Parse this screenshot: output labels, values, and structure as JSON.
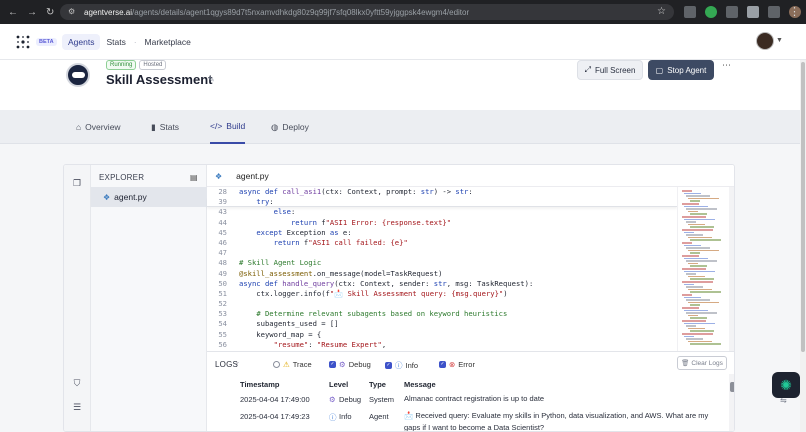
{
  "browser": {
    "url_host": "agentverse.ai",
    "url_path": "/agents/details/agent1qgys89d7t5nxamvdhkdg80z9q99jf7sfq08lkx0yftt59yjggpsk4ewgm4/editor"
  },
  "header": {
    "beta": "BETA",
    "nav": [
      {
        "label": "Agents",
        "active": true
      },
      {
        "label": "Stats",
        "active": false
      },
      {
        "label": "Marketplace",
        "active": false
      }
    ]
  },
  "agent": {
    "status_running": "Running",
    "status_hosted": "Hosted",
    "title": "Skill Assessment",
    "full_screen": "Full Screen",
    "stop_agent": "Stop Agent"
  },
  "tabs": [
    {
      "label": "Overview",
      "icon": "home-icon"
    },
    {
      "label": "Stats",
      "icon": "bar-chart-icon"
    },
    {
      "label": "Build",
      "icon": "code-icon",
      "active": true
    },
    {
      "label": "Deploy",
      "icon": "globe-icon"
    }
  ],
  "explorer": {
    "title": "EXPLORER",
    "file": "agent.py"
  },
  "editor": {
    "tab": "agent.py",
    "lines": [
      {
        "n": "28",
        "html": "<span class=\"kw\">async def</span> <span class=\"fn\">call_asi1</span>(ctx: Context, prompt: <span class=\"kw\">str</span>) -> <span class=\"kw\">str</span>:",
        "sticky": true
      },
      {
        "n": "39",
        "html": "    <span class=\"kw\">try</span>:",
        "sticky": true
      },
      {
        "n": "43",
        "html": "        <span class=\"kw\">else</span>:"
      },
      {
        "n": "44",
        "html": "            <span class=\"kw\">return</span> f<span class=\"str\">\"ASI1 Error: {response.text}\"</span>"
      },
      {
        "n": "45",
        "html": "    <span class=\"kw\">except</span> Exception <span class=\"kw\">as</span> e:"
      },
      {
        "n": "46",
        "html": "        <span class=\"kw\">return</span> f<span class=\"str\">\"ASI1 call failed: {e}\"</span>"
      },
      {
        "n": "47",
        "html": ""
      },
      {
        "n": "48",
        "html": "<span class=\"cmt\"># Skill Agent Logic</span>"
      },
      {
        "n": "49",
        "html": "<span class=\"dec\">@skill_assessment</span>.on_message(model=TaskRequest)"
      },
      {
        "n": "50",
        "html": "<span class=\"kw\">async def</span> <span class=\"fn\">handle_query</span>(ctx: Context, sender: <span class=\"kw\">str</span>, msg: TaskRequest):"
      },
      {
        "n": "51",
        "html": "    ctx.logger.info(f<span class=\"str\">\"📩 Skill Assessment query: {msg.query}\"</span>)"
      },
      {
        "n": "52",
        "html": ""
      },
      {
        "n": "53",
        "html": "    <span class=\"cmt\"># Determine relevant subagents based on keyword heuristics</span>"
      },
      {
        "n": "54",
        "html": "    subagents_used = []"
      },
      {
        "n": "55",
        "html": "    keyword_map = {"
      },
      {
        "n": "56",
        "html": "        <span class=\"str\">\"resume\"</span>: <span class=\"str\">\"Resume Expert\"</span>,"
      }
    ]
  },
  "logs": {
    "title": "LOGS",
    "filters": [
      {
        "label": "Trace",
        "type": "radio",
        "icon": "⚠"
      },
      {
        "label": "Debug",
        "type": "check",
        "icon": "⚙"
      },
      {
        "label": "Info",
        "type": "check",
        "icon": "ⓘ"
      },
      {
        "label": "Error",
        "type": "check",
        "icon": "⊗"
      }
    ],
    "clear": "Clear Logs",
    "columns": [
      "Timestamp",
      "Level",
      "Type",
      "Message"
    ],
    "rows": [
      {
        "ts": "2025-04-04 17:49:00",
        "level": "Debug",
        "level_icon": "⚙",
        "type": "System",
        "msg": "Almanac contract registration is up to date"
      },
      {
        "ts": "2025-04-04 17:49:23",
        "level": "Info",
        "level_icon": "ⓘ",
        "type": "Agent",
        "msg": "📩 Received query: Evaluate my skills in Python, data visualization, and AWS. What are my gaps if I want to become a Data Scientist?"
      }
    ]
  },
  "colors": {
    "accent": "#3a4ba8",
    "stop_button": "#3d4a63",
    "running": "#2f8f3a"
  }
}
